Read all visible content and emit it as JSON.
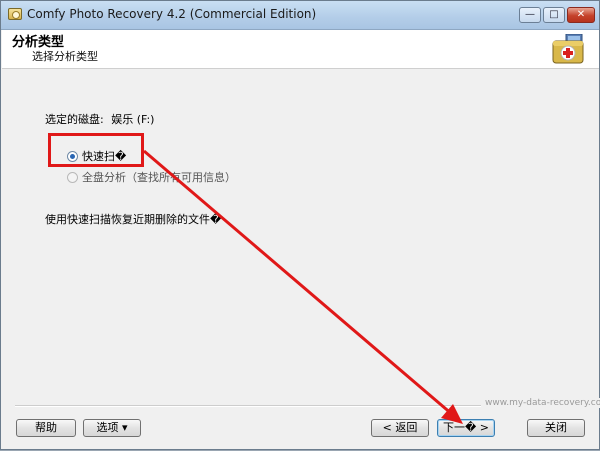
{
  "window": {
    "title": "Comfy Photo Recovery 4.2 (Commercial Edition)",
    "controls": {
      "minimize": "—",
      "maximize": "□",
      "close": "✕"
    }
  },
  "header": {
    "title": "分析类型",
    "subtitle": "选择分析类型",
    "icon": "first-aid-kit-icon"
  },
  "main": {
    "drive_label": "选定的磁盘:",
    "drive_value": "娱乐 (F:)",
    "options": [
      {
        "label": "快速扫�",
        "selected": true,
        "enabled": true
      },
      {
        "label": "全盘分析（查找所有可用信息）",
        "selected": false,
        "enabled": false
      }
    ],
    "description": "使用快速扫描恢复近期删除的文件�"
  },
  "footer": {
    "watermark": "www.my-data-recovery.com",
    "help": "帮助",
    "options": "选项 ▾",
    "back": "< 返回",
    "next": "下一� >",
    "close": "关闭"
  },
  "annotation": {
    "color": "#e01818"
  }
}
